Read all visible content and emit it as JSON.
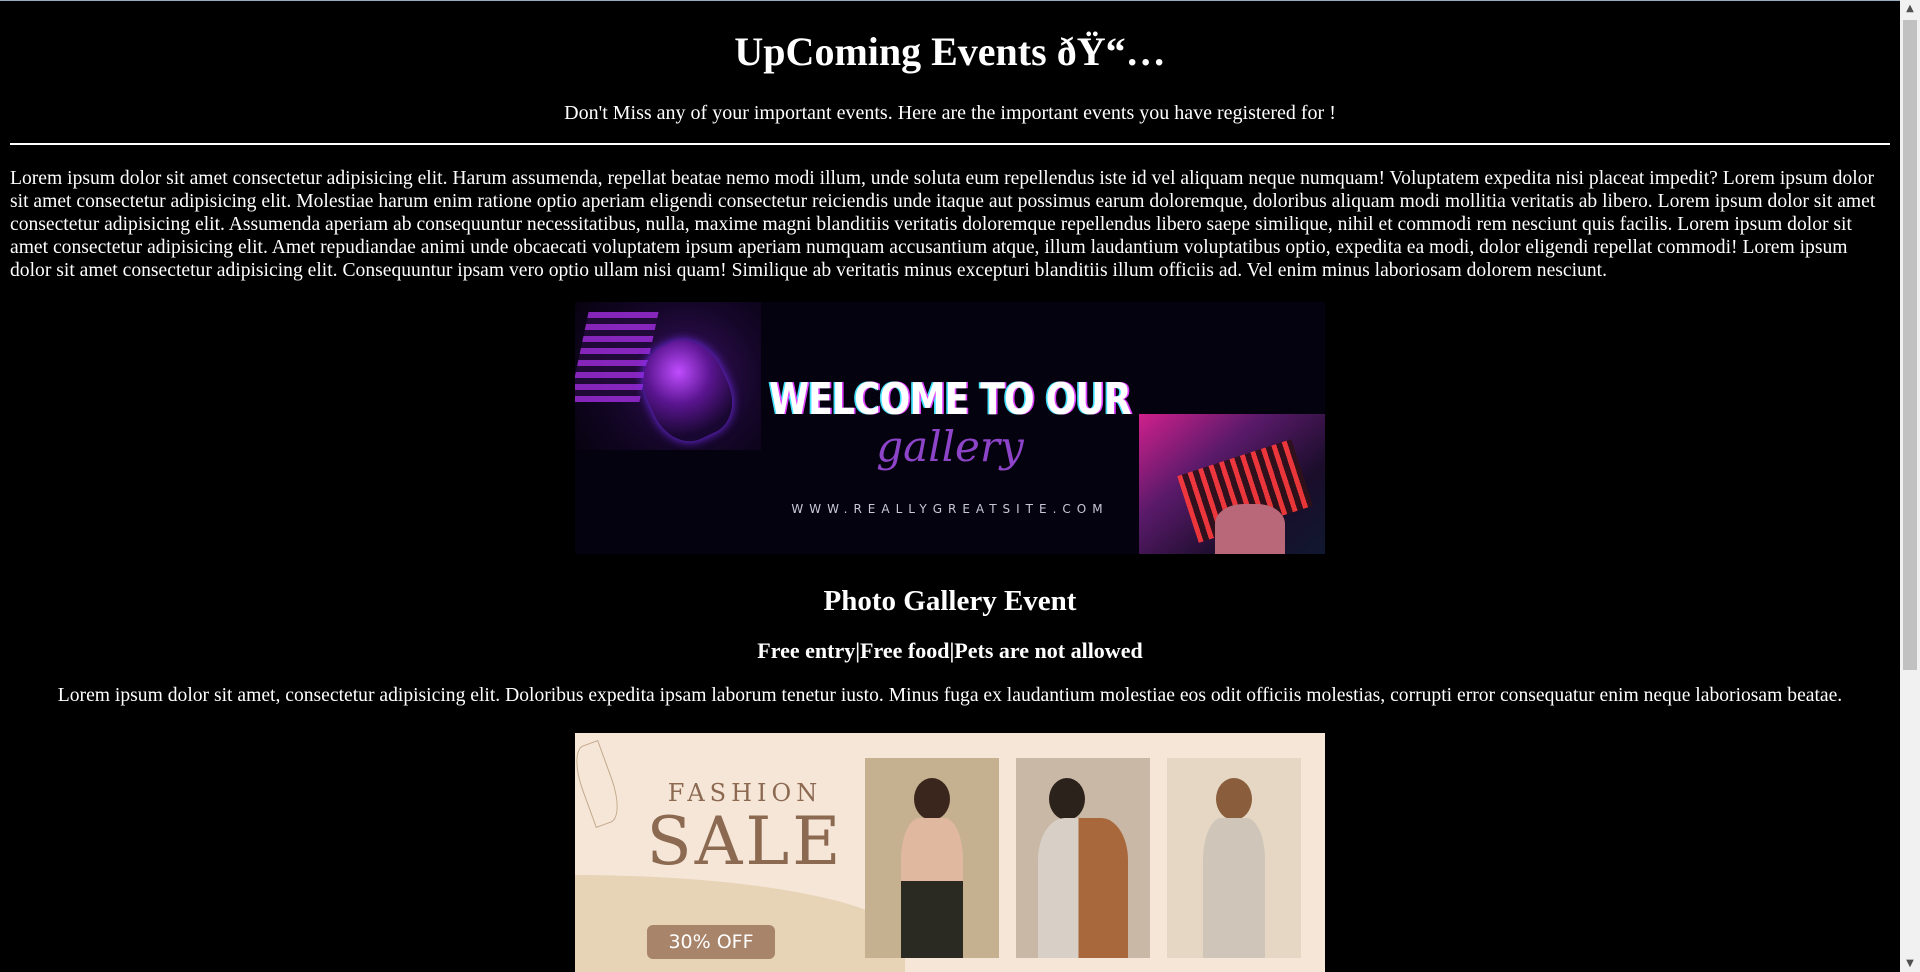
{
  "page": {
    "title": "UpComing Events ðŸ“…",
    "subtitle": "Don't Miss any of your important events. Here are the important events you have registered for !",
    "intro": "Lorem ipsum dolor sit amet consectetur adipisicing elit. Harum assumenda, repellat beatae nemo modi illum, unde soluta eum repellendus iste id vel aliquam neque numquam! Voluptatem expedita nisi placeat impedit? Lorem ipsum dolor sit amet consectetur adipisicing elit. Molestiae harum enim ratione optio aperiam eligendi consectetur reiciendis unde itaque aut possimus earum doloremque, doloribus aliquam modi mollitia veritatis ab libero. Lorem ipsum dolor sit amet consectetur adipisicing elit. Assumenda aperiam ab consequuntur necessitatibus, nulla, maxime magni blanditiis veritatis doloremque repellendus libero saepe similique, nihil et commodi rem nesciunt quis facilis. Lorem ipsum dolor sit amet consectetur adipisicing elit. Amet repudiandae animi unde obcaecati voluptatem ipsum aperiam numquam accusantium atque, illum laudantium voluptatibus optio, expedita ea modi, dolor eligendi repellat commodi! Lorem ipsum dolor sit amet consectetur adipisicing elit. Consequuntur ipsam vero optio ullam nisi quam! Similique ab veritatis minus excepturi blanditiis illum officiis ad. Vel enim minus laboriosam dolorem nesciunt."
  },
  "events": [
    {
      "banner": {
        "headline": "WELCOME TO OUR",
        "script": "gallery",
        "url": "WWW.REALLYGREATSITE.COM"
      },
      "title": "Photo Gallery Event",
      "tags": "Free entry|Free food|Pets are not allowed",
      "description": "Lorem ipsum dolor sit amet, consectetur adipisicing elit. Doloribus expedita ipsam laborum tenetur iusto. Minus fuga ex laudantium molestiae eos odit officiis molestias, corrupti error consequatur enim neque laboriosam beatae."
    },
    {
      "banner": {
        "line1": "FASHION",
        "line2": "SALE",
        "badge": "30% OFF"
      }
    }
  ],
  "scrollbar": {
    "up_icon": "scroll-up-arrow",
    "down_icon": "scroll-down-arrow"
  }
}
